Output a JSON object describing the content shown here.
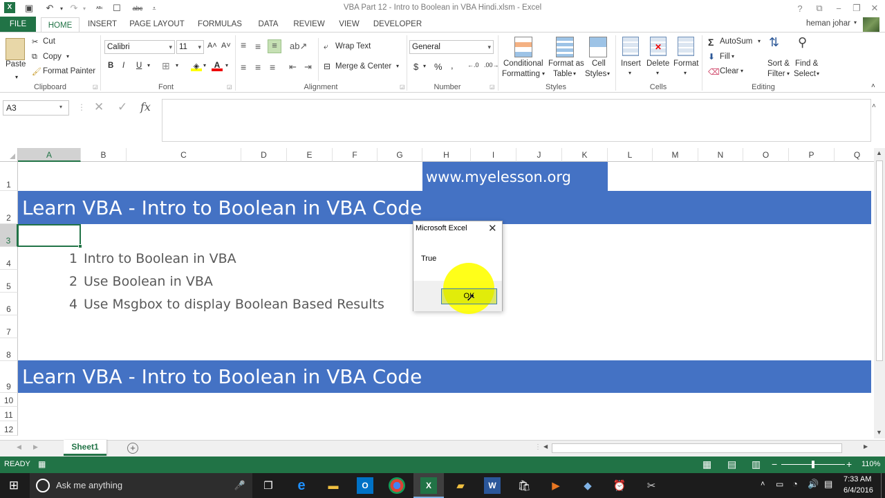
{
  "window": {
    "title": "VBA Part 12 -  Intro to Boolean in VBA Hindi.xlsm - Excel",
    "user": "heman johar"
  },
  "tabs": [
    "FILE",
    "HOME",
    "INSERT",
    "PAGE LAYOUT",
    "FORMULAS",
    "DATA",
    "REVIEW",
    "VIEW",
    "DEVELOPER"
  ],
  "active_tab": "HOME",
  "ribbon": {
    "clipboard": {
      "paste": "Paste",
      "cut": "Cut",
      "copy": "Copy",
      "format_painter": "Format Painter",
      "label": "Clipboard"
    },
    "font": {
      "name": "Calibri",
      "size": "11",
      "label": "Font"
    },
    "alignment": {
      "wrap": "Wrap Text",
      "merge": "Merge & Center",
      "label": "Alignment"
    },
    "number": {
      "format": "General",
      "label": "Number"
    },
    "styles": {
      "cond1": "Conditional",
      "cond2": "Formatting",
      "fmt1": "Format as",
      "fmt2": "Table",
      "cell1": "Cell",
      "cell2": "Styles",
      "label": "Styles"
    },
    "cells": {
      "insert": "Insert",
      "delete": "Delete",
      "format": "Format",
      "label": "Cells"
    },
    "editing": {
      "autosum": "AutoSum",
      "fill": "Fill",
      "clear": "Clear",
      "sort1": "Sort &",
      "sort2": "Filter",
      "find1": "Find &",
      "find2": "Select",
      "label": "Editing"
    }
  },
  "formula_bar": {
    "name_box": "A3",
    "fx": "fx",
    "value": ""
  },
  "columns": [
    "A",
    "B",
    "C",
    "D",
    "E",
    "F",
    "G",
    "H",
    "I",
    "J",
    "K",
    "L",
    "M",
    "N",
    "O",
    "P",
    "Q"
  ],
  "rows": [
    "1",
    "2",
    "3",
    "4",
    "5",
    "6",
    "7",
    "8",
    "9",
    "10",
    "11",
    "12"
  ],
  "selected_cell": "A3",
  "cells": {
    "url": "www.myelesson.org",
    "heading": "Learn VBA - Intro to Boolean in VBA Code",
    "items": [
      {
        "num": "1",
        "text": "Intro to Boolean in VBA"
      },
      {
        "num": "2",
        "text": "Use Boolean in VBA"
      },
      {
        "num": "4",
        "text": "Use Msgbox to display Boolean Based Results"
      }
    ],
    "footer_heading": "Learn VBA - Intro to Boolean in VBA Code"
  },
  "dialog": {
    "title": "Microsoft Excel",
    "message": "True",
    "button": "OK"
  },
  "sheet_tabs": [
    "Sheet1"
  ],
  "status": {
    "mode": "READY",
    "zoom": "110%"
  },
  "taskbar": {
    "search": "Ask me anything",
    "time": "7:33 AM",
    "date": "6/4/2016"
  },
  "colors": {
    "excel_green": "#217346",
    "band_blue": "#4472c4",
    "highlight_yellow": "#ffff00"
  }
}
